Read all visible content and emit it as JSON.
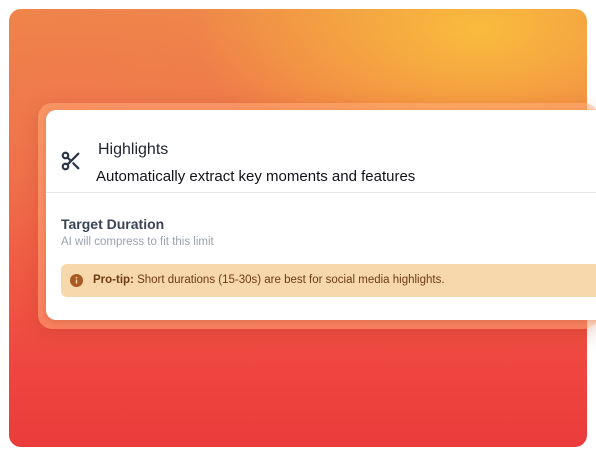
{
  "card": {
    "icon": "scissors-icon",
    "title": "Highlights",
    "subtitle": "Automatically extract key moments and features"
  },
  "target_duration": {
    "label": "Target Duration",
    "description": "AI will compress to fit this limit"
  },
  "tip": {
    "icon": "info-icon",
    "label": "Pro-tip:",
    "text": " Short durations (15-30s) are best for social media highlights."
  },
  "colors": {
    "background_top": "#f0a040",
    "background_bottom": "#ea3c3c",
    "tip_background": "#f7d7ac",
    "tip_text": "#6e3b12",
    "icon": "#2d3648"
  }
}
